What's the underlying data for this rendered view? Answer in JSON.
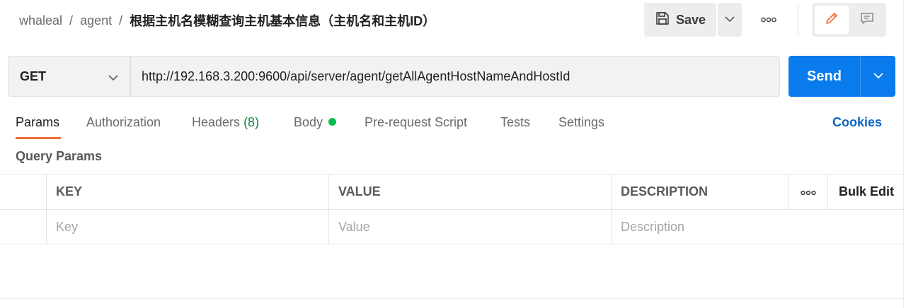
{
  "breadcrumb": {
    "items": [
      "whaleal",
      "agent"
    ],
    "separator": "/",
    "current": "根据主机名模糊查询主机基本信息（主机名和主机ID）"
  },
  "header": {
    "save_label": "Save",
    "more_icon": "ellipsis-icon",
    "edit_icon": "pencil-icon",
    "comment_icon": "comment-icon"
  },
  "request": {
    "method": "GET",
    "url": "http://192.168.3.200:9600/api/server/agent/getAllAgentHostNameAndHostId",
    "send_label": "Send"
  },
  "tabs": [
    {
      "label": "Params",
      "active": true
    },
    {
      "label": "Authorization"
    },
    {
      "label": "Headers",
      "count": "(8)"
    },
    {
      "label": "Body",
      "indicator": "green-dot"
    },
    {
      "label": "Pre-request Script"
    },
    {
      "label": "Tests"
    },
    {
      "label": "Settings"
    }
  ],
  "cookies_label": "Cookies",
  "query_params": {
    "title": "Query Params",
    "columns": [
      "KEY",
      "VALUE",
      "DESCRIPTION"
    ],
    "bulk_edit_label": "Bulk Edit",
    "placeholders": {
      "key": "Key",
      "value": "Value",
      "description": "Description"
    }
  },
  "colors": {
    "accent": "#f26b3a",
    "send": "#097bed",
    "link": "#0a66c2",
    "success": "#0cbb52"
  }
}
